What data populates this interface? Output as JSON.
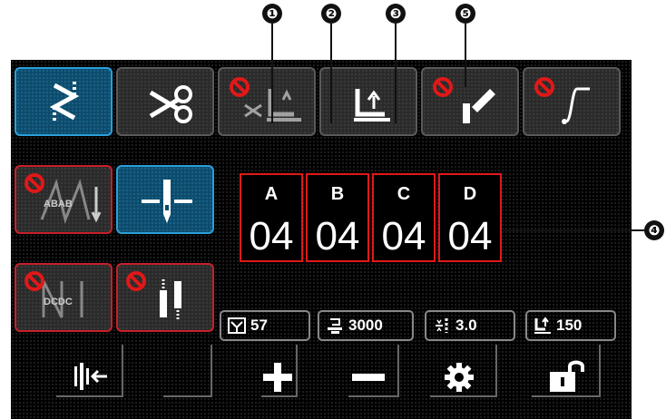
{
  "callouts": {
    "c1": "❶",
    "c2": "❷",
    "c3": "❸",
    "c4": "❹",
    "c5": "❺"
  },
  "buttons": [
    {
      "id": "pattern",
      "icon": "zigzag-pattern-icon",
      "state": "selected"
    },
    {
      "id": "thread-trimmer",
      "icon": "scissors-icon",
      "state": "normal"
    },
    {
      "id": "trim-presser-lift",
      "icon": "trim-presser-foot-lift-icon",
      "state": "prohibited"
    },
    {
      "id": "presser-foot-lift",
      "icon": "presser-foot-lift-icon",
      "state": "normal"
    },
    {
      "id": "needle-threading",
      "icon": "threading-pen-icon",
      "state": "prohibited"
    },
    {
      "id": "soft-start",
      "icon": "soft-start-curve-icon",
      "state": "prohibited"
    },
    {
      "id": "reverse-ab",
      "icon": "reverse-stitch-ab-icon",
      "label": "ABAB",
      "state": "prohibited"
    },
    {
      "id": "needle-position",
      "icon": "needle-up-down-icon",
      "state": "selected"
    },
    {
      "id": "reverse-cd",
      "icon": "reverse-stitch-cd-icon",
      "label": "DCDC",
      "state": "prohibited"
    },
    {
      "id": "condensed-stitch",
      "icon": "condensed-stitch-icon",
      "state": "prohibited"
    }
  ],
  "stitch_counts": [
    {
      "letter": "A",
      "value": "04"
    },
    {
      "letter": "B",
      "value": "04"
    },
    {
      "letter": "C",
      "value": "04"
    },
    {
      "letter": "D",
      "value": "04"
    }
  ],
  "info_boxes": [
    {
      "icon": "counter-icon",
      "value": "57"
    },
    {
      "icon": "sewing-speed-icon",
      "value": "3000"
    },
    {
      "icon": "stitch-length-icon",
      "value": "3.0"
    },
    {
      "icon": "presser-foot-pressure-icon",
      "value": "150"
    }
  ],
  "bottom_bar": [
    {
      "icon": "sewing-mode-icon"
    },
    {
      "icon": "blank"
    },
    {
      "icon": "plus-icon"
    },
    {
      "icon": "minus-icon"
    },
    {
      "icon": "gear-icon"
    },
    {
      "icon": "unlock-icon"
    }
  ],
  "colors": {
    "accent_blue": "#2aa0d8",
    "prohibit_red": "#e01818",
    "panel": "#000000"
  }
}
